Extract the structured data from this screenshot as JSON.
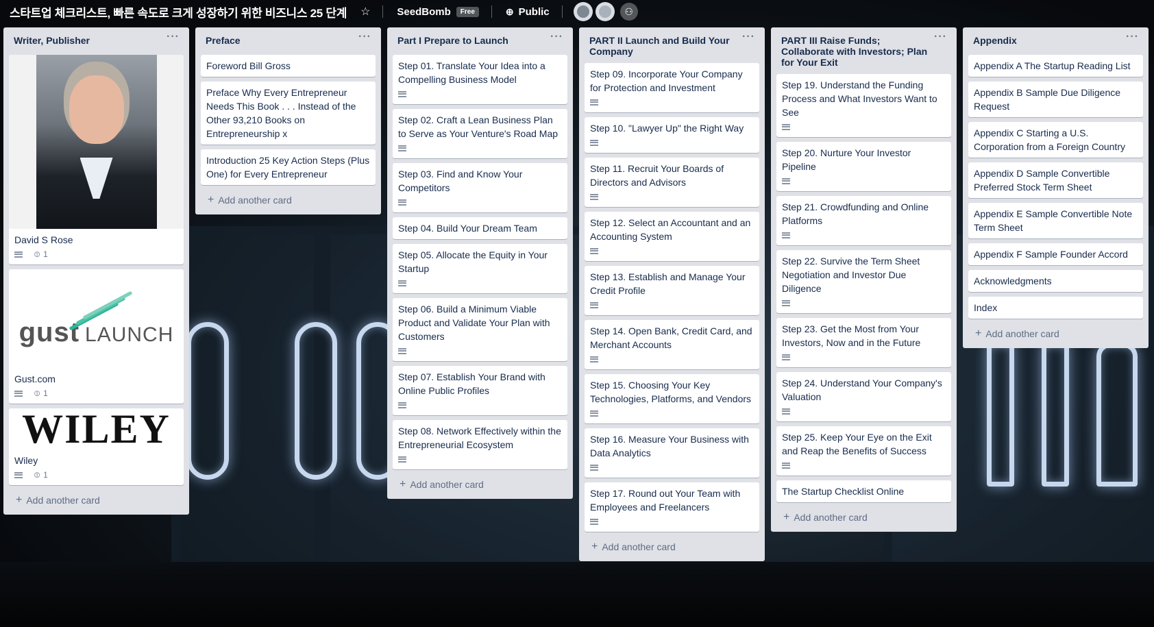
{
  "topbar": {
    "board_title": "스타트업 체크리스트, 빠른 속도로 크게 성장하기 위한 비즈니스 25 단계",
    "star_icon": "star-icon",
    "team_name": "SeedBomb",
    "team_badge": "Free",
    "visibility": "Public",
    "globe_icon": "globe-icon",
    "add_member_icon": "add-member-icon"
  },
  "lists": [
    {
      "title": "Writer, Publisher",
      "cards": [
        {
          "title": "David S Rose",
          "cover": "author-photo",
          "has_description": true,
          "attachments": "1"
        },
        {
          "title": "Gust.com",
          "cover": "gust-launch-logo",
          "has_description": true,
          "attachments": "1"
        },
        {
          "title": "Wiley",
          "cover": "wiley-logo",
          "has_description": true,
          "attachments": "1"
        }
      ],
      "add_card": "Add another card"
    },
    {
      "title": "Preface",
      "cards": [
        {
          "title": "Foreword Bill Gross"
        },
        {
          "title": "Preface Why Every Entrepreneur Needs This Book . . .  Instead of the Other 93,210 Books on Entrepreneurship x"
        },
        {
          "title": "Introduction 25 Key Action Steps (Plus One) for Every Entrepreneur"
        }
      ],
      "add_card": "Add another card"
    },
    {
      "title": "Part I Prepare to Launch",
      "cards": [
        {
          "title": "Step 01. Translate Your Idea into a Compelling Business Model",
          "has_description": true
        },
        {
          "title": "Step 02. Craft a Lean Business Plan to Serve as Your Venture's Road Map",
          "has_description": true
        },
        {
          "title": "Step 03. Find and Know Your Competitors",
          "has_description": true
        },
        {
          "title": "Step 04. Build Your Dream Team"
        },
        {
          "title": "Step 05. Allocate the Equity in Your Startup",
          "has_description": true
        },
        {
          "title": "Step 06. Build a Minimum Viable Product and Validate Your Plan with Customers",
          "has_description": true
        },
        {
          "title": "Step 07. Establish Your Brand with Online Public Profiles",
          "has_description": true
        },
        {
          "title": "Step 08. Network Effectively within the Entrepreneurial Ecosystem",
          "has_description": true
        }
      ],
      "add_card": "Add another card"
    },
    {
      "title": "PART II Launch and Build Your Company",
      "cards": [
        {
          "title": "Step 09. Incorporate Your Company for Protection and Investment",
          "has_description": true
        },
        {
          "title": "Step 10. \"Lawyer Up\" the Right Way",
          "has_description": true
        },
        {
          "title": "Step 11. Recruit Your Boards of Directors and Advisors",
          "has_description": true
        },
        {
          "title": "Step 12. Select an Accountant and an Accounting System",
          "has_description": true
        },
        {
          "title": "Step 13. Establish and Manage Your Credit Profile",
          "has_description": true
        },
        {
          "title": "Step 14. Open Bank, Credit Card, and Merchant Accounts",
          "has_description": true
        },
        {
          "title": "Step 15. Choosing Your Key Technologies, Platforms, and Vendors",
          "has_description": true
        },
        {
          "title": "Step 16. Measure Your Business with Data Analytics",
          "has_description": true
        },
        {
          "title": "Step 17. Round out Your Team with Employees and Freelancers",
          "has_description": true
        }
      ],
      "add_card": "Add another card"
    },
    {
      "title": "PART III Raise Funds; Collaborate with Investors; Plan for Your Exit",
      "cards": [
        {
          "title": "Step 19. Understand the Funding Process and What Investors Want to See",
          "has_description": true
        },
        {
          "title": "Step 20. Nurture Your Investor Pipeline",
          "has_description": true
        },
        {
          "title": "Step 21. Crowdfunding and Online Platforms",
          "has_description": true
        },
        {
          "title": "Step 22. Survive the Term Sheet Negotiation and Investor Due Diligence",
          "has_description": true
        },
        {
          "title": "Step 23. Get the Most from Your Investors, Now and in the Future",
          "has_description": true
        },
        {
          "title": "Step 24. Understand Your Company's Valuation",
          "has_description": true
        },
        {
          "title": "Step 25. Keep Your Eye on the Exit and Reap the Benefits of Success",
          "has_description": true
        },
        {
          "title": "The Startup Checklist Online"
        }
      ],
      "add_card": "Add another card"
    },
    {
      "title": "Appendix",
      "cards": [
        {
          "title": "Appendix A The Startup Reading List"
        },
        {
          "title": "Appendix B Sample Due Diligence Request"
        },
        {
          "title": "Appendix C Starting a U.S. Corporation from a Foreign Country"
        },
        {
          "title": "Appendix D Sample Convertible Preferred Stock Term Sheet"
        },
        {
          "title": "Appendix E Sample Convertible Note Term Sheet"
        },
        {
          "title": "Appendix F Sample Founder Accord"
        },
        {
          "title": "Acknowledgments"
        },
        {
          "title": "Index"
        }
      ],
      "add_card": "Add another card"
    }
  ],
  "covers": {
    "gust_logo_main": "gust",
    "gust_logo_sub": "LAUNCH",
    "wiley_logo": "WILEY"
  },
  "list_menu_label": "···",
  "colors": {
    "list_bg": "#dfe1e6",
    "card_bg": "#ffffff",
    "text": "#172b4d",
    "muted": "#5e6c84",
    "gust_green": "#2bb59a"
  }
}
